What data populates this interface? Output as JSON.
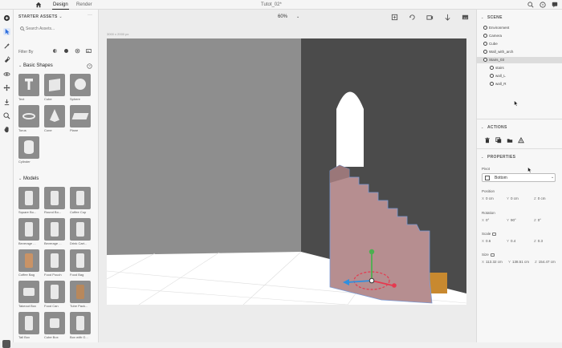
{
  "topbar": {
    "tabs": [
      {
        "label": "Design",
        "active": true
      },
      {
        "label": "Render",
        "active": false
      }
    ],
    "title": "Tutot_02*",
    "right_icons": [
      "search-icon",
      "help-icon",
      "chat-icon"
    ]
  },
  "tools": [
    "add-icon",
    "select-icon",
    "magic-wand-icon",
    "paint-icon",
    "orbit-icon",
    "move-icon",
    "drop-icon",
    "zoom-icon",
    "hand-icon"
  ],
  "assets": {
    "header": "STARTER ASSETS",
    "search_placeholder": "Search Assets...",
    "filter_label": "Filter By",
    "basic_shapes": {
      "title": "Basic Shapes",
      "items": [
        {
          "label": "Text"
        },
        {
          "label": "Cube"
        },
        {
          "label": "Sphere"
        },
        {
          "label": "Torus"
        },
        {
          "label": "Cone"
        },
        {
          "label": "Plane"
        },
        {
          "label": "Cylinder"
        }
      ]
    },
    "models": {
      "title": "Models",
      "items": [
        {
          "label": "Square Bo..."
        },
        {
          "label": "Round Bo..."
        },
        {
          "label": "Coffee Cup"
        },
        {
          "label": "Beverage ..."
        },
        {
          "label": "Beverage ..."
        },
        {
          "label": "Drink Cart..."
        },
        {
          "label": "Coffee Bag"
        },
        {
          "label": "Food Pouch"
        },
        {
          "label": "Food Bag"
        },
        {
          "label": "Takeout Box"
        },
        {
          "label": "Food Can"
        },
        {
          "label": "Tube Pack..."
        },
        {
          "label": "Tall Box"
        },
        {
          "label": "Cube Box"
        },
        {
          "label": "Box with G..."
        }
      ]
    }
  },
  "canvas": {
    "zoom": "60%",
    "size_label": "3000 x 2000 px"
  },
  "scene": {
    "header": "SCENE",
    "items": [
      {
        "label": "Environment",
        "depth": 0,
        "selected": false
      },
      {
        "label": "Camera",
        "depth": 0,
        "selected": false
      },
      {
        "label": "Cube",
        "depth": 0,
        "selected": false
      },
      {
        "label": "Wall_with_arch",
        "depth": 0,
        "selected": false
      },
      {
        "label": "Stairs_03",
        "depth": 0,
        "selected": true
      },
      {
        "label": "stairs",
        "depth": 1,
        "selected": false
      },
      {
        "label": "wall_L",
        "depth": 1,
        "selected": false
      },
      {
        "label": "wall_R",
        "depth": 1,
        "selected": false
      }
    ]
  },
  "actions": {
    "header": "ACTIONS",
    "icons": [
      "delete-icon",
      "duplicate-icon",
      "group-icon",
      "align-icon"
    ]
  },
  "properties": {
    "header": "PROPERTIES",
    "pivot_label": "Pivot",
    "pivot_value": "Bottom",
    "position_label": "Position",
    "position": {
      "x": "0 cm",
      "y": "0 cm",
      "z": "0 cm"
    },
    "rotation_label": "Rotation",
    "rotation": {
      "x": "0°",
      "y": "90°",
      "z": "0°"
    },
    "scale_label": "Scale",
    "scale": {
      "x": "0.6",
      "y": "0.4",
      "z": "0.3"
    },
    "size_label": "Size",
    "size": {
      "x": "113.32 cm",
      "y": "138.51 cm",
      "z": "154.47 cm"
    }
  }
}
